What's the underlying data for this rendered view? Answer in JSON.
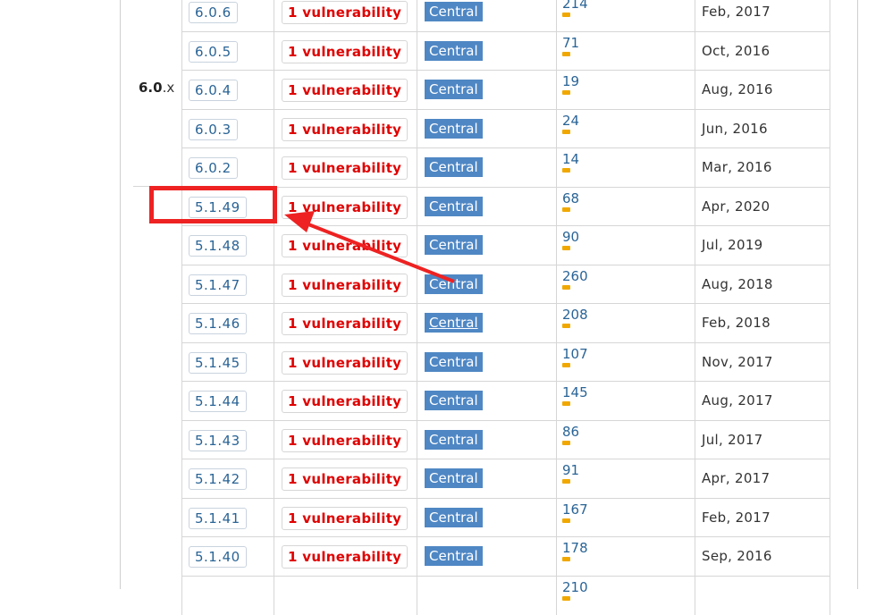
{
  "version_group": {
    "major": "6.0",
    "suffix": ".x"
  },
  "rows": [
    {
      "version": "6.0.6",
      "vulnerabilities": "1 vulnerability",
      "repository": "Central",
      "usages": "214",
      "date": "Feb, 2017"
    },
    {
      "version": "6.0.5",
      "vulnerabilities": "1 vulnerability",
      "repository": "Central",
      "usages": "71",
      "date": "Oct, 2016"
    },
    {
      "version": "6.0.4",
      "vulnerabilities": "1 vulnerability",
      "repository": "Central",
      "usages": "19",
      "date": "Aug, 2016"
    },
    {
      "version": "6.0.3",
      "vulnerabilities": "1 vulnerability",
      "repository": "Central",
      "usages": "24",
      "date": "Jun, 2016"
    },
    {
      "version": "6.0.2",
      "vulnerabilities": "1 vulnerability",
      "repository": "Central",
      "usages": "14",
      "date": "Mar, 2016"
    },
    {
      "version": "5.1.49",
      "vulnerabilities": "1 vulnerability",
      "repository": "Central",
      "usages": "68",
      "date": "Apr, 2020"
    },
    {
      "version": "5.1.48",
      "vulnerabilities": "1 vulnerability",
      "repository": "Central",
      "usages": "90",
      "date": "Jul, 2019"
    },
    {
      "version": "5.1.47",
      "vulnerabilities": "1 vulnerability",
      "repository": "Central",
      "usages": "260",
      "date": "Aug, 2018"
    },
    {
      "version": "5.1.46",
      "vulnerabilities": "1 vulnerability",
      "repository": "Central",
      "usages": "208",
      "date": "Feb, 2018"
    },
    {
      "version": "5.1.45",
      "vulnerabilities": "1 vulnerability",
      "repository": "Central",
      "usages": "107",
      "date": "Nov, 2017"
    },
    {
      "version": "5.1.44",
      "vulnerabilities": "1 vulnerability",
      "repository": "Central",
      "usages": "145",
      "date": "Aug, 2017"
    },
    {
      "version": "5.1.43",
      "vulnerabilities": "1 vulnerability",
      "repository": "Central",
      "usages": "86",
      "date": "Jul, 2017"
    },
    {
      "version": "5.1.42",
      "vulnerabilities": "1 vulnerability",
      "repository": "Central",
      "usages": "91",
      "date": "Apr, 2017"
    },
    {
      "version": "5.1.41",
      "vulnerabilities": "1 vulnerability",
      "repository": "Central",
      "usages": "167",
      "date": "Feb, 2017"
    },
    {
      "version": "5.1.40",
      "vulnerabilities": "1 vulnerability",
      "repository": "Central",
      "usages": "178",
      "date": "Sep, 2016"
    },
    {
      "version": "",
      "vulnerabilities": "",
      "repository": "",
      "usages": "210",
      "date": ""
    }
  ],
  "annotation": {
    "highlighted_version": "5.1.49",
    "color": "#ee2222"
  },
  "colors": {
    "vulnerability_text": "#e00000",
    "repository_badge": "#4f87c4",
    "link_text": "#2a6496",
    "usage_bar": "#f0a800"
  }
}
